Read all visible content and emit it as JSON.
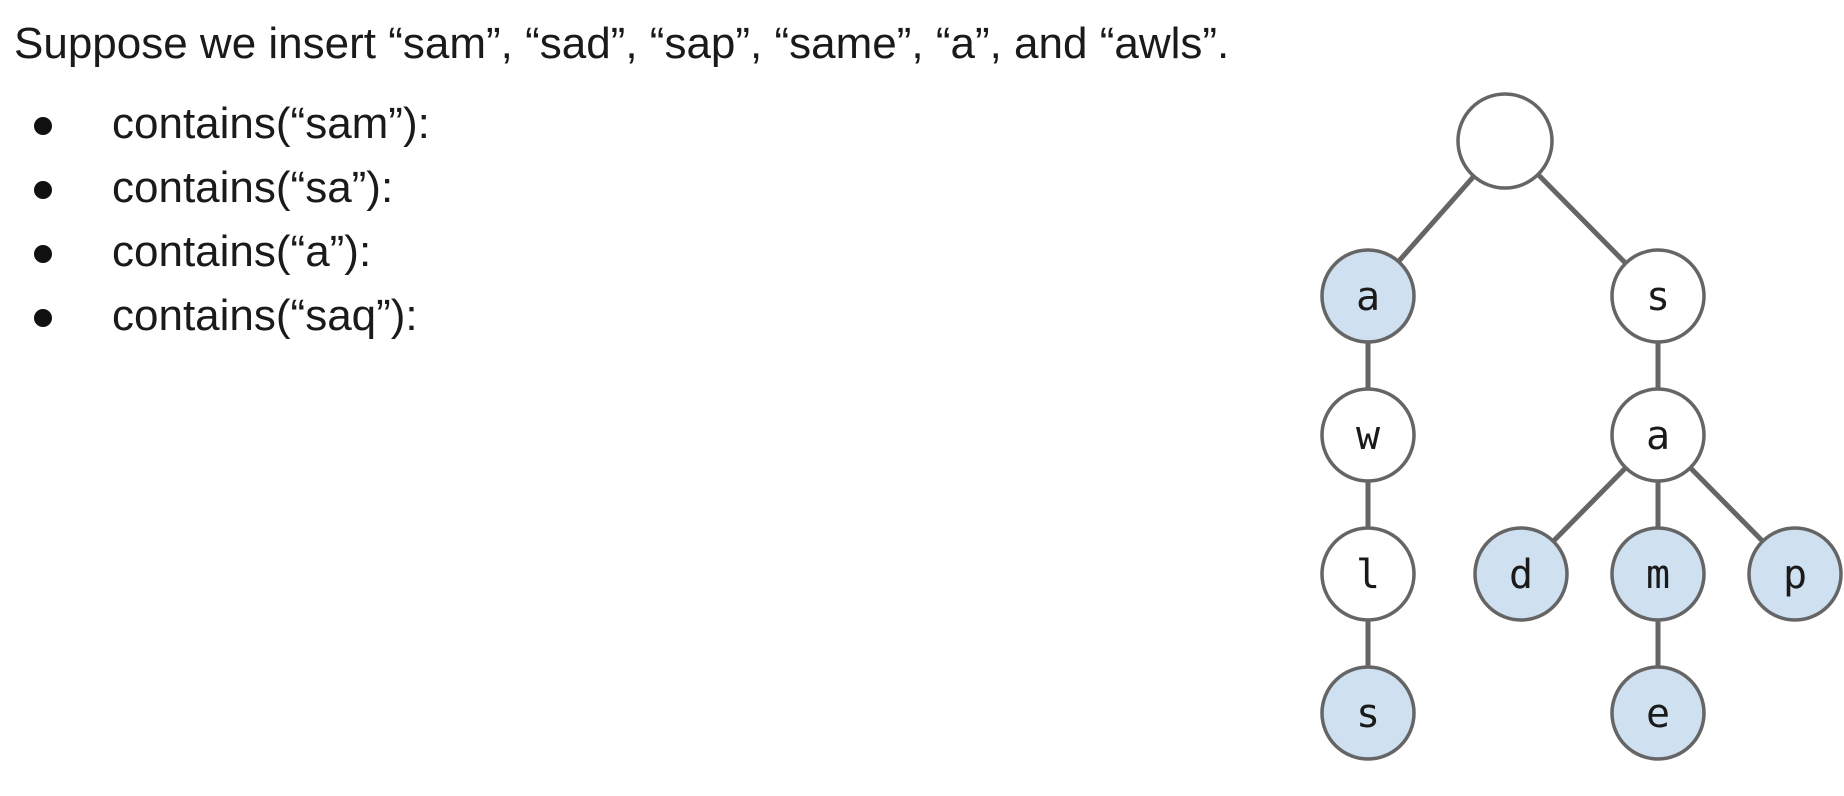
{
  "intro": "Suppose we insert “sam”, “sad”, “sap”, “same”, “a”, and “awls”.",
  "queries": [
    "contains(“sam”):",
    "contains(“sa”):",
    "contains(“a”):",
    "contains(“saq”):"
  ],
  "trie": {
    "colors": {
      "key_fill": "#cfe0f1",
      "nonkey_fill": "#ffffff",
      "stroke": "#656565"
    },
    "root": {
      "label": "",
      "is_key": false,
      "children": [
        {
          "label": "a",
          "is_key": true,
          "children": [
            {
              "label": "w",
              "is_key": false,
              "children": [
                {
                  "label": "l",
                  "is_key": false,
                  "children": [
                    {
                      "label": "s",
                      "is_key": true,
                      "children": []
                    }
                  ]
                }
              ]
            }
          ]
        },
        {
          "label": "s",
          "is_key": false,
          "children": [
            {
              "label": "a",
              "is_key": false,
              "children": [
                {
                  "label": "d",
                  "is_key": true,
                  "children": []
                },
                {
                  "label": "m",
                  "is_key": true,
                  "children": [
                    {
                      "label": "e",
                      "is_key": true,
                      "children": []
                    }
                  ]
                },
                {
                  "label": "p",
                  "is_key": true,
                  "children": []
                }
              ]
            }
          ]
        }
      ]
    }
  }
}
